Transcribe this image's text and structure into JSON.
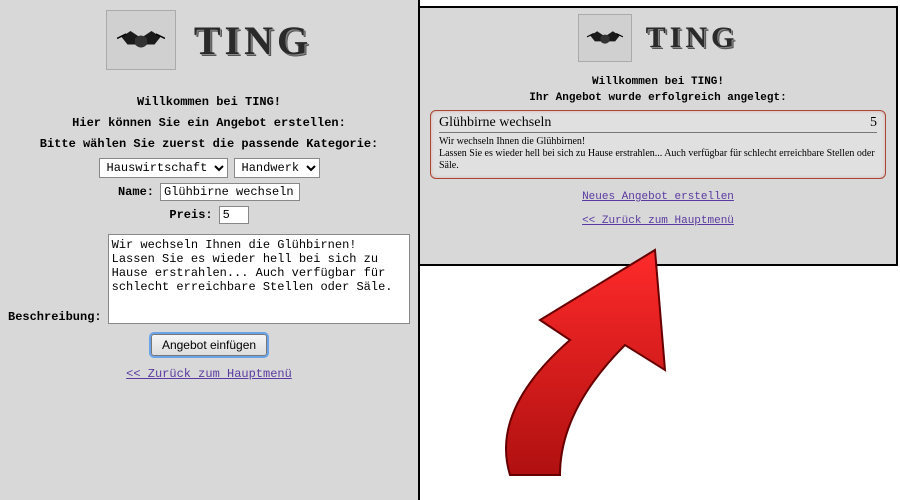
{
  "brand": "TING",
  "left": {
    "welcome": "Willkommen bei TING!",
    "subtitle": "Hier können Sie ein Angebot erstellen:",
    "category_prompt": "Bitte wählen Sie zuerst die passende Kategorie:",
    "category1": "Hauswirtschaft",
    "category2": "Handwerk",
    "name_label": "Name:",
    "name_value": "Glühbirne wechseln",
    "price_label": "Preis:",
    "price_value": "5",
    "desc_label": "Beschreibung:",
    "desc_value": "Wir wechseln Ihnen die Glühbirnen!\nLassen Sie es wieder hell bei sich zu Hause erstrahlen... Auch verfügbar für schlecht erreichbare Stellen oder Säle.",
    "submit_label": "Angebot einfügen",
    "back_link": "<< Zurück zum Hauptmenü"
  },
  "right": {
    "welcome": "Willkommen bei TING!",
    "success": "Ihr Angebot wurde erfolgreich angelegt:",
    "card_title": "Glühbirne wechseln",
    "card_price": "5",
    "card_body1": "Wir wechseln Ihnen die Glühbirnen!",
    "card_body2": "Lassen Sie es wieder hell bei sich zu Hause erstrahlen... Auch verfügbar für schlecht erreichbare Stellen oder Säle.",
    "new_link": "Neues Angebot erstellen",
    "back_link": "<< Zurück zum Hauptmenü"
  }
}
